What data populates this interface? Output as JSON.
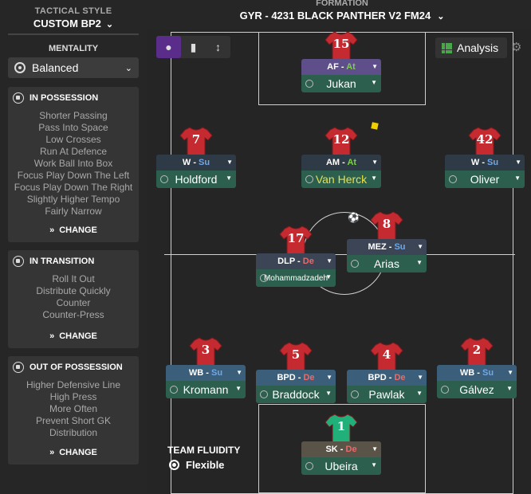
{
  "sidebar": {
    "tactical_style_label": "TACTICAL STYLE",
    "tactical_style_value": "CUSTOM BP2",
    "mentality_label": "MENTALITY",
    "mentality_value": "Balanced",
    "panels": [
      {
        "title": "IN POSSESSION",
        "items": [
          "Shorter Passing",
          "Pass Into Space",
          "Low Crosses",
          "Run At Defence",
          "Work Ball Into Box",
          "Focus Play Down The Left",
          "Focus Play Down The Right",
          "Slightly Higher Tempo",
          "Fairly Narrow"
        ],
        "change": "CHANGE"
      },
      {
        "title": "IN TRANSITION",
        "items": [
          "Roll It Out",
          "Distribute Quickly",
          "Counter",
          "Counter-Press"
        ],
        "change": "CHANGE"
      },
      {
        "title": "OUT OF POSSESSION",
        "items": [
          "Higher Defensive Line",
          "High Press",
          "More Often",
          "Prevent Short GK",
          "Distribution"
        ],
        "change": "CHANGE"
      }
    ]
  },
  "formation": {
    "label": "FORMATION",
    "name": "GYR - 4231 BLACK PANTHER V2 FM24"
  },
  "toolbar": {
    "analysis_label": "Analysis"
  },
  "players": [
    {
      "num": "15",
      "role": "AF",
      "duty": "At",
      "name": "Jukan",
      "shirt": "red",
      "duty_color": "#7ccf4a",
      "role_bg": "#5e4e8a"
    },
    {
      "num": "7",
      "role": "W",
      "duty": "Su",
      "name": "Holdford",
      "shirt": "red",
      "duty_color": "#6fa8e8",
      "role_bg": "#2f3a47"
    },
    {
      "num": "12",
      "role": "AM",
      "duty": "At",
      "name": "Van Herck",
      "shirt": "red",
      "duty_color": "#7ccf4a",
      "role_bg": "#2f3a47",
      "name_color": "#e8e04a"
    },
    {
      "num": "42",
      "role": "W",
      "duty": "Su",
      "name": "Oliver",
      "shirt": "red",
      "duty_color": "#6fa8e8",
      "role_bg": "#2f3a47"
    },
    {
      "num": "17",
      "role": "DLP",
      "duty": "De",
      "name": "Mohammadzadeh",
      "shirt": "red",
      "duty_color": "#e86a6a",
      "role_bg": "#3b4555"
    },
    {
      "num": "8",
      "role": "MEZ",
      "duty": "Su",
      "name": "Arias",
      "shirt": "red",
      "duty_color": "#6fa8e8",
      "role_bg": "#3b4555"
    },
    {
      "num": "3",
      "role": "WB",
      "duty": "Su",
      "name": "Kromann",
      "shirt": "red",
      "duty_color": "#6fa8e8",
      "role_bg": "#3b5f7a"
    },
    {
      "num": "5",
      "role": "BPD",
      "duty": "De",
      "name": "Braddock",
      "shirt": "red",
      "duty_color": "#e86a6a",
      "role_bg": "#3b5f7a"
    },
    {
      "num": "4",
      "role": "BPD",
      "duty": "De",
      "name": "Pawlak",
      "shirt": "red",
      "duty_color": "#e86a6a",
      "role_bg": "#3b5f7a"
    },
    {
      "num": "2",
      "role": "WB",
      "duty": "Su",
      "name": "Gálvez",
      "shirt": "red",
      "duty_color": "#6fa8e8",
      "role_bg": "#3b5f7a"
    },
    {
      "num": "1",
      "role": "SK",
      "duty": "De",
      "name": "Ubeira",
      "shirt": "green",
      "duty_color": "#e86a6a",
      "role_bg": "#5a5448"
    }
  ],
  "fluidity": {
    "label": "TEAM FLUIDITY",
    "value": "Flexible"
  },
  "colors": {
    "shirt_red": "#c42a30",
    "shirt_green": "#22b07a",
    "name_bg": "#2d5f4e"
  }
}
